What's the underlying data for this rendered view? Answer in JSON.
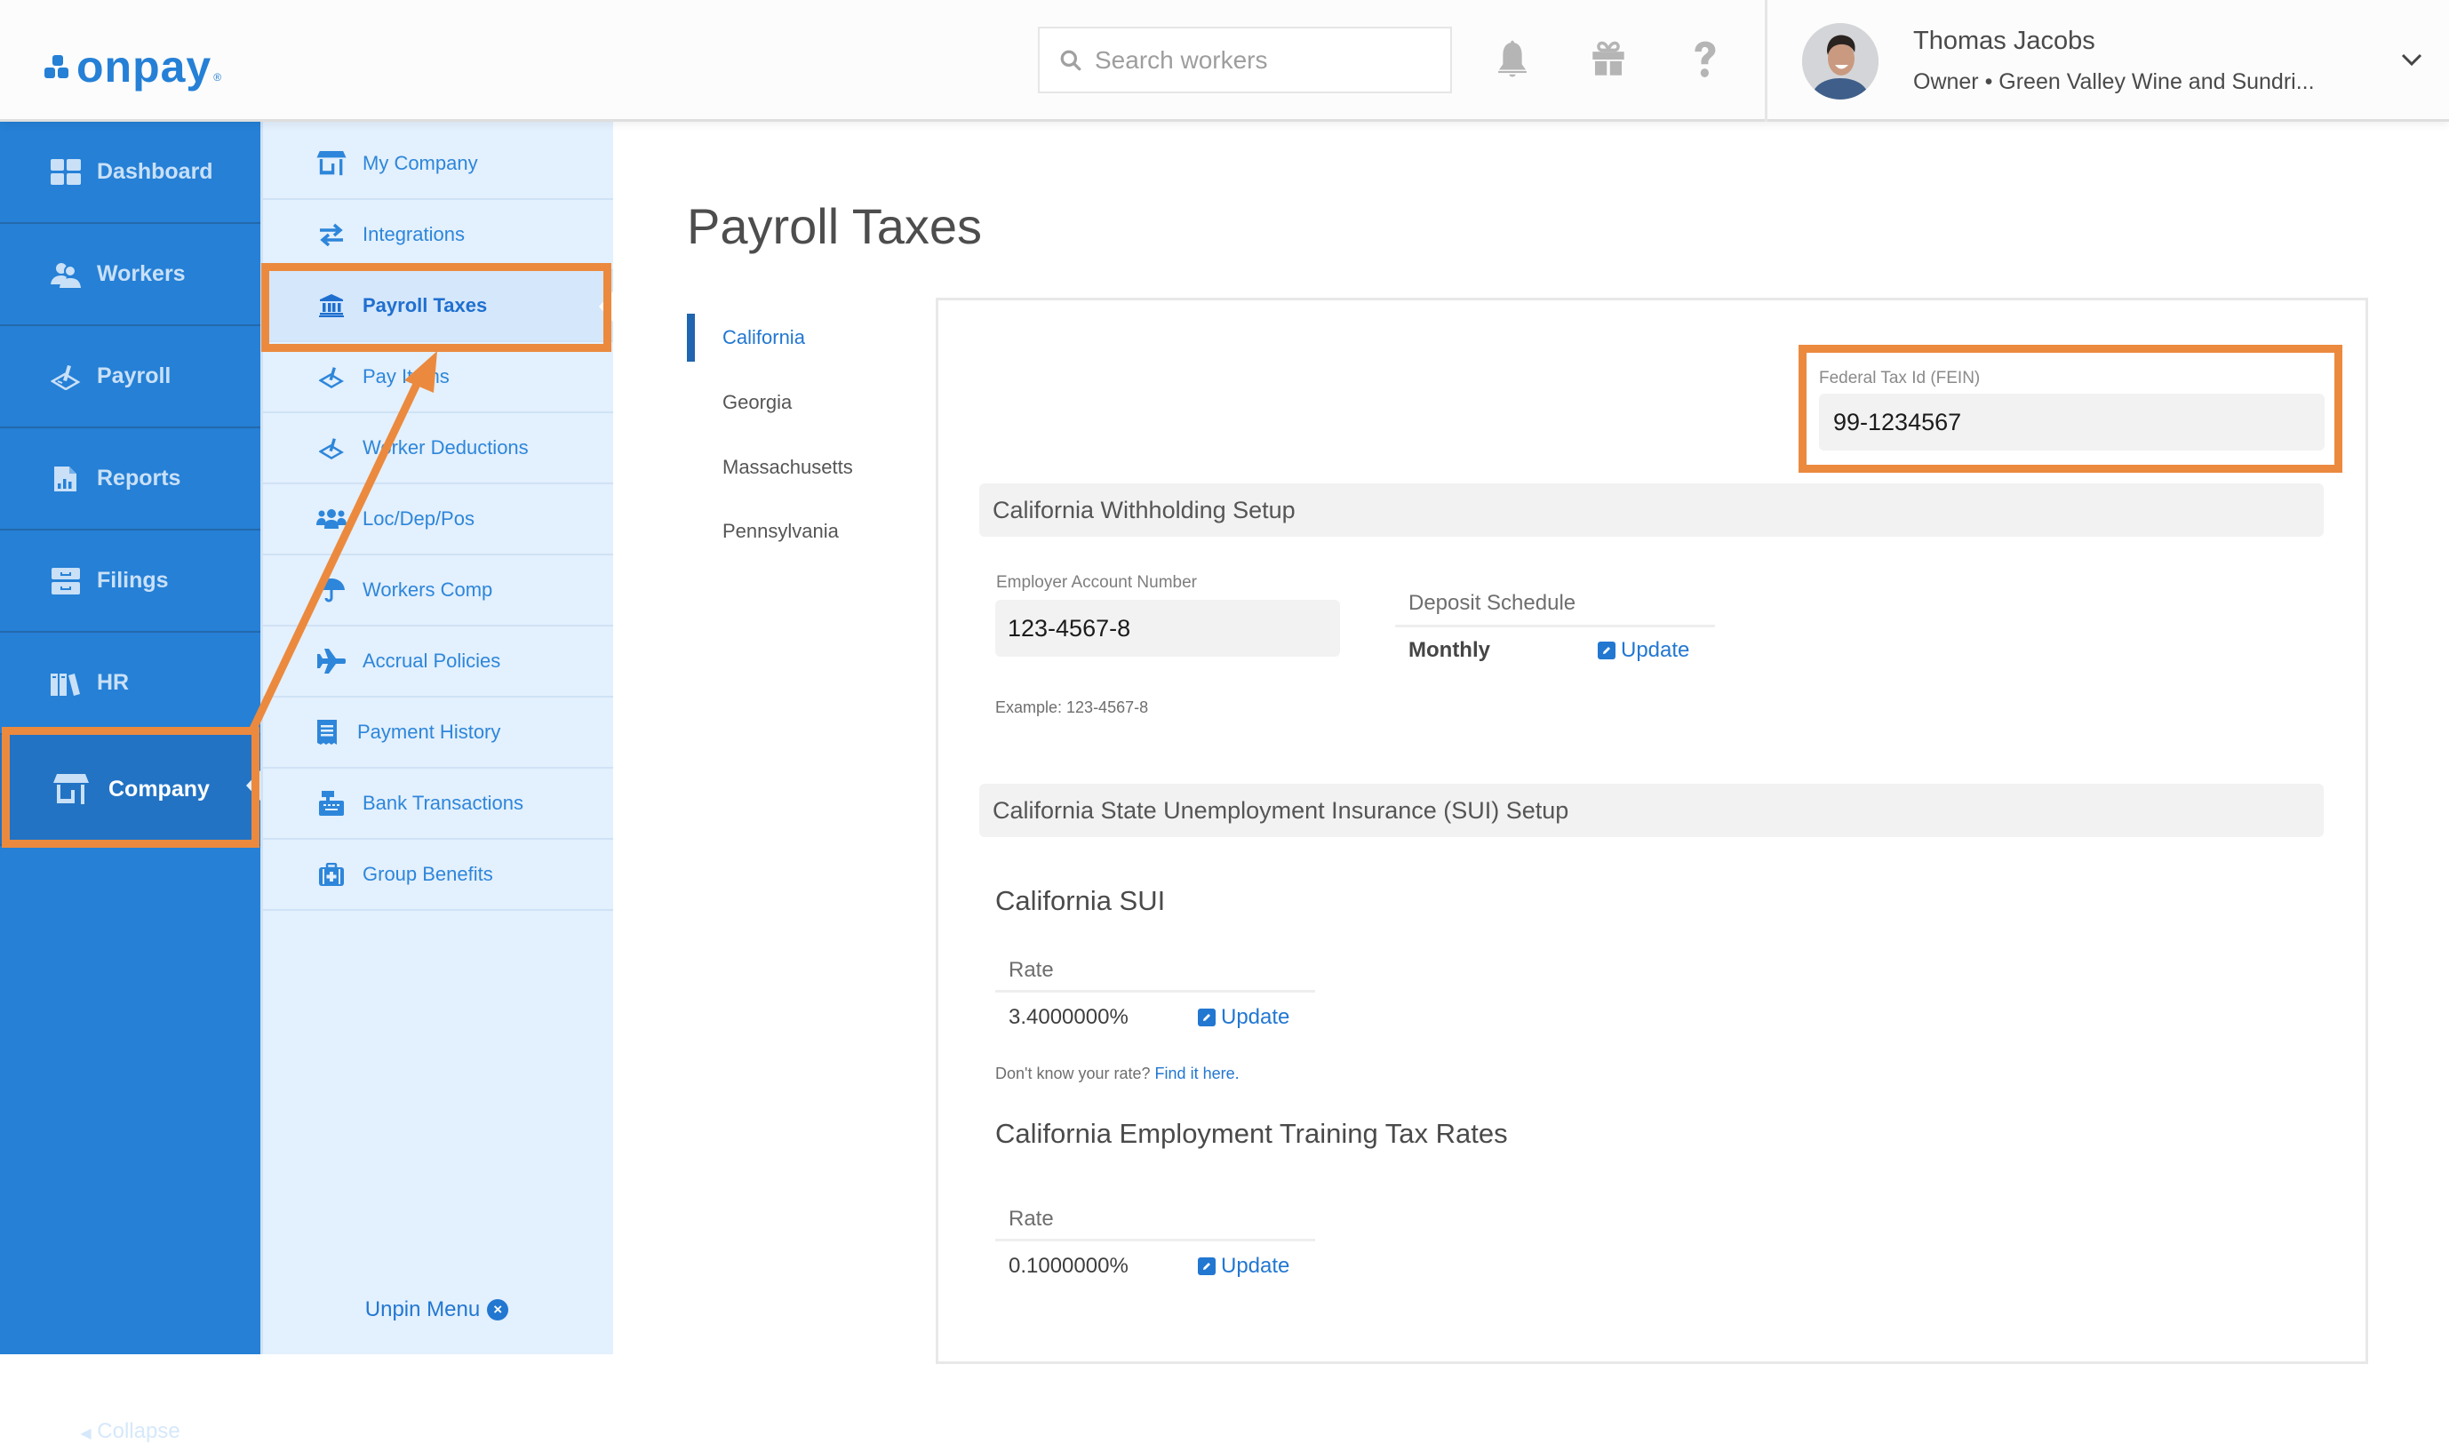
{
  "header": {
    "logo_text": "onpay",
    "logo_reg": "®",
    "search": {
      "placeholder": "Search workers",
      "value": "",
      "icon": "search-icon"
    },
    "icons": [
      "bell-icon",
      "gift-icon",
      "help-icon"
    ],
    "user": {
      "name": "Thomas Jacobs",
      "role_company": "Owner • Green Valley Wine and Sundri...",
      "avatar": "avatar"
    }
  },
  "sidebar": {
    "items": [
      {
        "label": "Dashboard",
        "icon": "dashboard-icon"
      },
      {
        "label": "Workers",
        "icon": "workers-icon"
      },
      {
        "label": "Payroll",
        "icon": "payroll-icon"
      },
      {
        "label": "Reports",
        "icon": "reports-icon"
      },
      {
        "label": "Filings",
        "icon": "filings-icon"
      },
      {
        "label": "HR",
        "icon": "hr-icon"
      },
      {
        "label": "Company",
        "icon": "company-icon",
        "active": true
      }
    ],
    "collapse_label": "Collapse"
  },
  "subnav": {
    "items": [
      {
        "label": "My Company",
        "icon": "store-icon"
      },
      {
        "label": "Integrations",
        "icon": "exchange-icon"
      },
      {
        "label": "Payroll Taxes",
        "icon": "bank-icon",
        "active": true
      },
      {
        "label": "Pay Items",
        "icon": "signature-icon"
      },
      {
        "label": "Worker Deductions",
        "icon": "signature-icon"
      },
      {
        "label": "Loc/Dep/Pos",
        "icon": "users-icon"
      },
      {
        "label": "Workers Comp",
        "icon": "umbrella-icon"
      },
      {
        "label": "Accrual Policies",
        "icon": "plane-icon"
      },
      {
        "label": "Payment History",
        "icon": "receipt-icon"
      },
      {
        "label": "Bank Transactions",
        "icon": "cash-register-icon"
      },
      {
        "label": "Group Benefits",
        "icon": "medkit-icon"
      }
    ],
    "unpin_label": "Unpin Menu"
  },
  "main": {
    "title": "Payroll Taxes",
    "states": [
      {
        "label": "California",
        "active": true
      },
      {
        "label": "Georgia"
      },
      {
        "label": "Massachusetts"
      },
      {
        "label": "Pennsylvania"
      }
    ],
    "fein": {
      "label": "Federal Tax Id (FEIN)",
      "value": "99-1234567"
    },
    "withholding": {
      "title": "California Withholding Setup",
      "employer_account_label": "Employer Account Number",
      "employer_account_value": "123-4567-8",
      "example": "Example: 123-4567-8",
      "deposit_schedule_label": "Deposit Schedule",
      "deposit_schedule_value": "Monthly",
      "update_label": "Update"
    },
    "sui": {
      "title": "California State Unemployment Insurance (SUI) Setup",
      "subheading": "California SUI",
      "rate_label": "Rate",
      "rate_value": "3.4000000%",
      "update_label": "Update",
      "help_text": "Don't know your rate?",
      "help_link": "Find it here."
    },
    "ett": {
      "subheading": "California Employment Training Tax Rates",
      "rate_label": "Rate",
      "rate_value": "0.1000000%",
      "update_label": "Update"
    }
  },
  "annotation": {
    "color": "#eb8a3e"
  },
  "colors": {
    "brand": "#2580d6",
    "link": "#2277d1",
    "subnav_bg": "#e3f0fd"
  }
}
